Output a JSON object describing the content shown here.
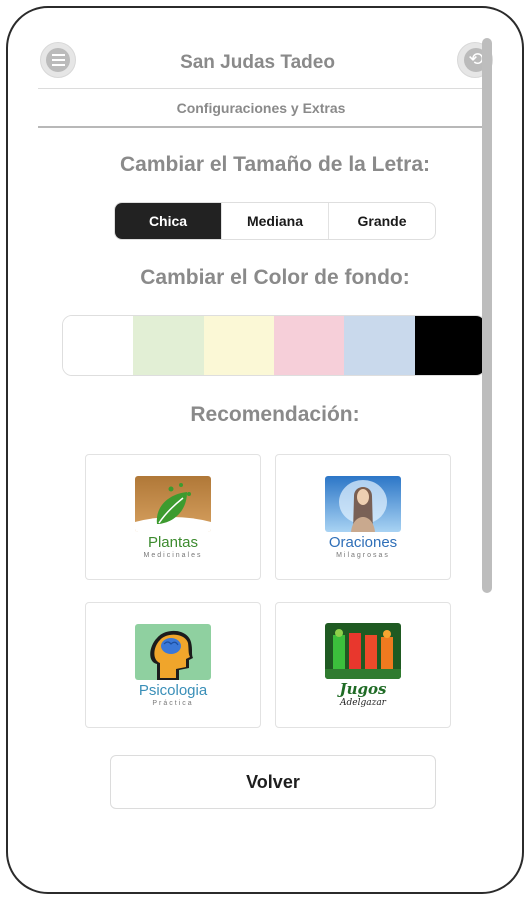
{
  "header": {
    "title": "San Judas Tadeo",
    "subtitle": "Configuraciones y Extras"
  },
  "icons": {
    "menu": "menu-icon",
    "right": "back-icon"
  },
  "font_size": {
    "title": "Cambiar el Tamaño de la Letra:",
    "options": [
      "Chica",
      "Mediana",
      "Grande"
    ],
    "selected": "Chica"
  },
  "background": {
    "title": "Cambiar el Color de fondo:",
    "swatches": [
      "#ffffff",
      "#e2efd5",
      "#fbf8d6",
      "#f6cfd9",
      "#c9d9ec",
      "#000000"
    ]
  },
  "recommendations": {
    "title": "Recomendación:",
    "apps": [
      {
        "name": "Plantas",
        "sub": "Medicinales"
      },
      {
        "name": "Oraciones",
        "sub": "Milagrosas"
      },
      {
        "name": "Psicologia",
        "sub": "Práctica"
      },
      {
        "name": "Jugos",
        "sub": "Adelgazar"
      }
    ]
  },
  "footer": {
    "back_label": "Volver"
  }
}
